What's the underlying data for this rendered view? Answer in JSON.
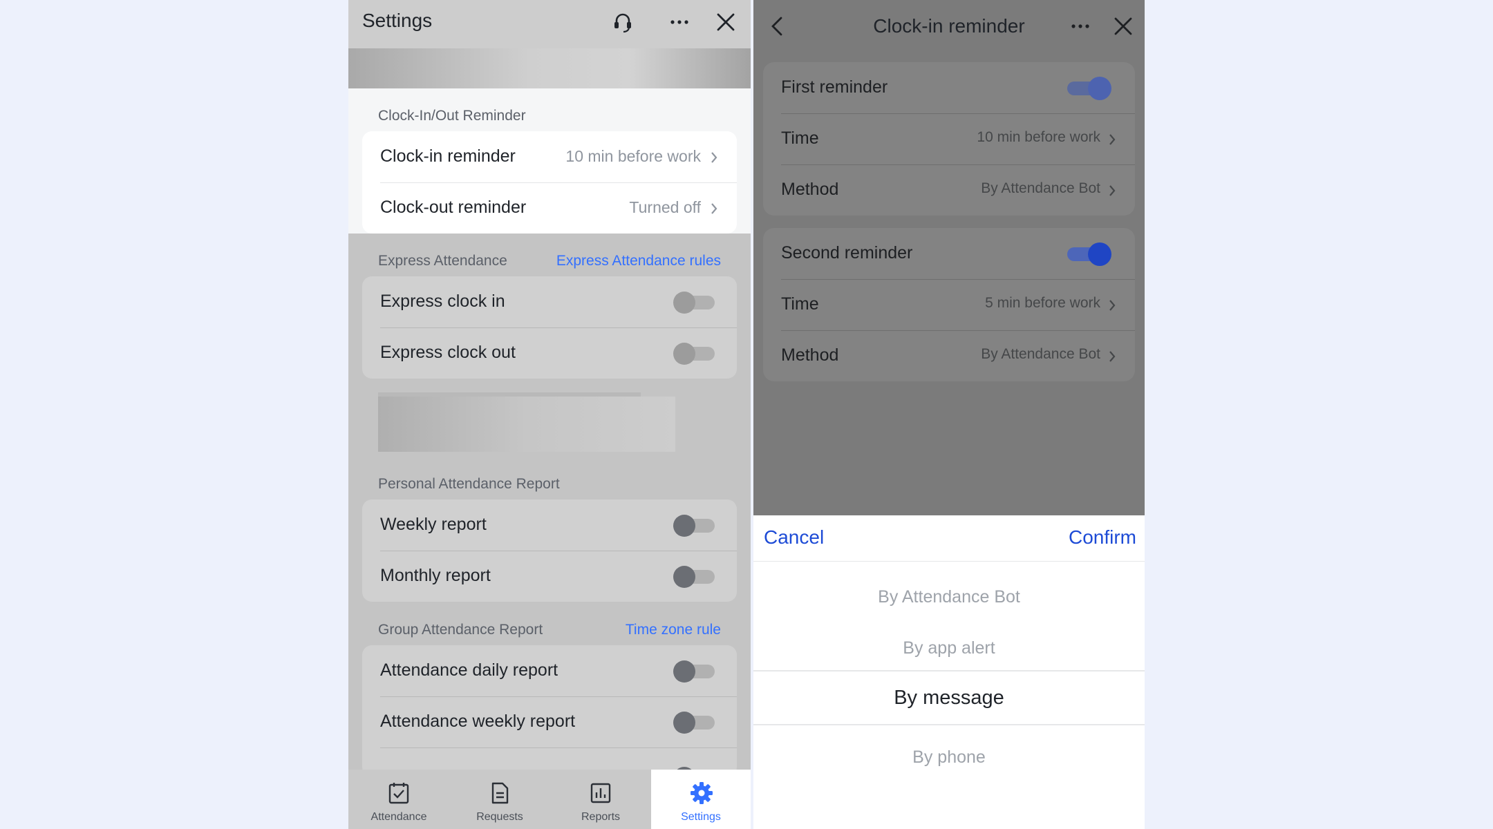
{
  "left": {
    "header": {
      "title": "Settings",
      "icons": [
        "headset-icon",
        "more-icon",
        "close-icon"
      ]
    },
    "clock_reminder": {
      "section_label": "Clock-In/Out Reminder",
      "rows": [
        {
          "label": "Clock-in reminder",
          "value": "10 min before work"
        },
        {
          "label": "Clock-out reminder",
          "value": "Turned off"
        }
      ]
    },
    "express_attendance": {
      "section_label": "Express Attendance",
      "link": "Express Attendance rules",
      "rows": [
        {
          "label": "Express clock in",
          "on": false
        },
        {
          "label": "Express clock out",
          "on": false
        }
      ]
    },
    "personal_report": {
      "section_label": "Personal Attendance Report",
      "rows": [
        {
          "label": "Weekly report",
          "on": false
        },
        {
          "label": "Monthly report",
          "on": false
        }
      ]
    },
    "group_report": {
      "section_label": "Group Attendance Report",
      "link": "Time zone rule",
      "rows": [
        {
          "label": "Attendance daily report",
          "on": false
        },
        {
          "label": "Attendance weekly report",
          "on": false
        }
      ]
    },
    "tabs": [
      {
        "label": "Attendance",
        "icon": "attendance-icon",
        "active": false
      },
      {
        "label": "Requests",
        "icon": "requests-icon",
        "active": false
      },
      {
        "label": "Reports",
        "icon": "reports-icon",
        "active": false
      },
      {
        "label": "Settings",
        "icon": "settings-gear-icon",
        "active": true
      }
    ]
  },
  "right": {
    "header": {
      "title": "Clock-in reminder",
      "icons": [
        "back-icon",
        "more-icon",
        "close-icon"
      ]
    },
    "first": {
      "label": "First reminder",
      "on": true,
      "time_label": "Time",
      "time_value": "10 min before work",
      "method_label": "Method",
      "method_value": "By Attendance Bot"
    },
    "second": {
      "label": "Second reminder",
      "on": true,
      "time_label": "Time",
      "time_value": "5 min before work",
      "method_label": "Method",
      "method_value": "By Attendance Bot"
    },
    "picker": {
      "cancel": "Cancel",
      "confirm": "Confirm",
      "options": [
        "By Attendance Bot",
        "By app alert",
        "By message",
        "By phone"
      ],
      "selected": "By message"
    }
  },
  "colors": {
    "accent": "#3370ff",
    "picker_action": "#1d4bd6",
    "background": "#edf1fc"
  }
}
